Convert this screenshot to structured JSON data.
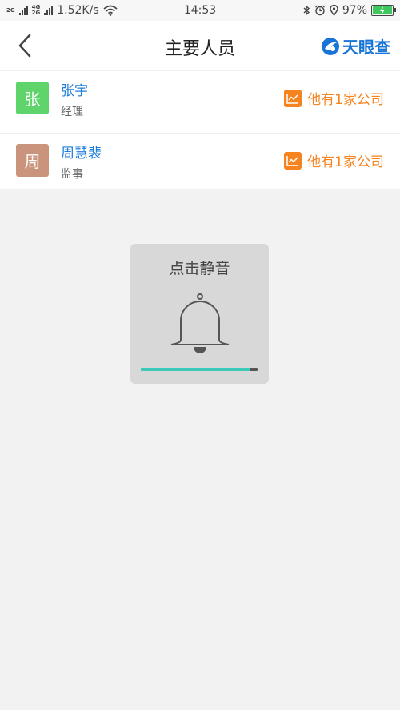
{
  "status_bar": {
    "net1": "2G",
    "net2_top": "4G",
    "net2_bottom": "2G",
    "speed": "1.52K/s",
    "time": "14:53",
    "battery": "97%"
  },
  "header": {
    "title": "主要人员",
    "brand": "天眼查"
  },
  "people": [
    {
      "avatar_char": "张",
      "avatar_color": "#5ed46a",
      "name": "张宇",
      "role": "经理",
      "companies": "他有1家公司"
    },
    {
      "avatar_char": "周",
      "avatar_color": "#c9937c",
      "name": "周慧裴",
      "role": "监事",
      "companies": "他有1家公司"
    }
  ],
  "toast": {
    "label": "点击静音",
    "volume_level": 0.94
  },
  "colors": {
    "brand_blue": "#1874d6",
    "link_blue": "#1f7ed8",
    "accent_orange": "#f5831f",
    "volume_teal": "#3ccab8"
  },
  "icons": [
    "signal-icon",
    "wifi-icon",
    "bluetooth-icon",
    "alarm-icon",
    "location-icon",
    "battery-icon",
    "back-icon",
    "brand-logo-icon",
    "trend-icon",
    "bell-icon"
  ]
}
